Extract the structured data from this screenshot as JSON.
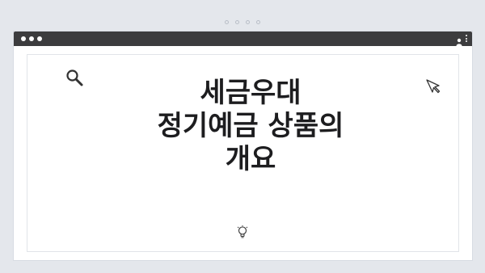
{
  "headline": {
    "lines": [
      "세금우대",
      "정기예금 상품의",
      "개요"
    ]
  },
  "icons": {
    "search": "search-icon",
    "cursor": "cursor-arrow-icon",
    "bulb": "lightbulb-icon",
    "profile": "profile-icon",
    "kebab": "kebab-menu-icon",
    "traffic": [
      "window-dot-icon",
      "window-dot-icon",
      "window-dot-icon"
    ]
  },
  "colors": {
    "background": "#e4e7ec",
    "titlebar": "#3c3c3e",
    "headline": "#1d1d1f",
    "icon_stroke": "#333333"
  }
}
